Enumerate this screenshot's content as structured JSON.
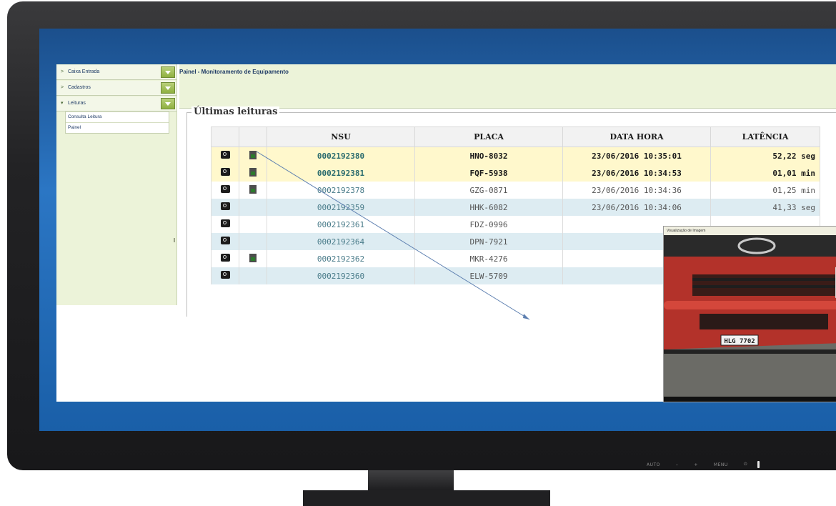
{
  "sidebar": {
    "items": [
      {
        "label": "Caixa Entrada",
        "arrow": ">"
      },
      {
        "label": "Cadastros",
        "arrow": ">"
      },
      {
        "label": "Leituras",
        "arrow": "▾"
      }
    ],
    "submenu": [
      {
        "label": "Consulta Leitura"
      },
      {
        "label": "Painel"
      }
    ]
  },
  "header": {
    "title": "Painel - Monitoramento de Equipamento"
  },
  "readings": {
    "legend": "Últimas leituras",
    "columns": [
      "NSU",
      "PLACA",
      "DATA HORA",
      "LATÊNCIA"
    ],
    "rows": [
      {
        "nsu": "0002192380",
        "placa": "HNO-8032",
        "data_hora": "23/06/2016 10:35:01",
        "latencia": "52,22 seg"
      },
      {
        "nsu": "0002192381",
        "placa": "FQF-5938",
        "data_hora": "23/06/2016 10:34:53",
        "latencia": "01,01 min"
      },
      {
        "nsu": "0002192378",
        "placa": "GZG-0871",
        "data_hora": "23/06/2016 10:34:36",
        "latencia": "01,25 min"
      },
      {
        "nsu": "0002192359",
        "placa": "HHK-6082",
        "data_hora": "23/06/2016 10:34:06",
        "latencia": "41,33 seg"
      },
      {
        "nsu": "0002192361",
        "placa": "FDZ-0996",
        "data_hora": "",
        "latencia": ""
      },
      {
        "nsu": "0002192364",
        "placa": "DPN-7921",
        "data_hora": "",
        "latencia": ""
      },
      {
        "nsu": "0002192362",
        "placa": "MKR-4276",
        "data_hora": "",
        "latencia": ""
      },
      {
        "nsu": "0002192360",
        "placa": "ELW-5709",
        "data_hora": "",
        "latencia": ""
      }
    ],
    "row_icons": [
      {
        "camera": true,
        "document": true
      },
      {
        "camera": true,
        "document": true
      },
      {
        "camera": true,
        "document": true
      },
      {
        "camera": true,
        "document": false
      },
      {
        "camera": true,
        "document": false
      },
      {
        "camera": true,
        "document": false
      },
      {
        "camera": true,
        "document": true
      },
      {
        "camera": true,
        "document": false
      }
    ]
  },
  "preview": {
    "title": "Visualização de Imagem",
    "plate": "HLG 7702"
  },
  "monitor": {
    "buttons": [
      "AUTO",
      "–",
      "+",
      "MENU"
    ]
  },
  "colors": {
    "accent": "#2b76c4",
    "highlight_row": "#fff8cc",
    "alt_row": "#ddecf2",
    "sidebar": "#ecf3d9"
  }
}
